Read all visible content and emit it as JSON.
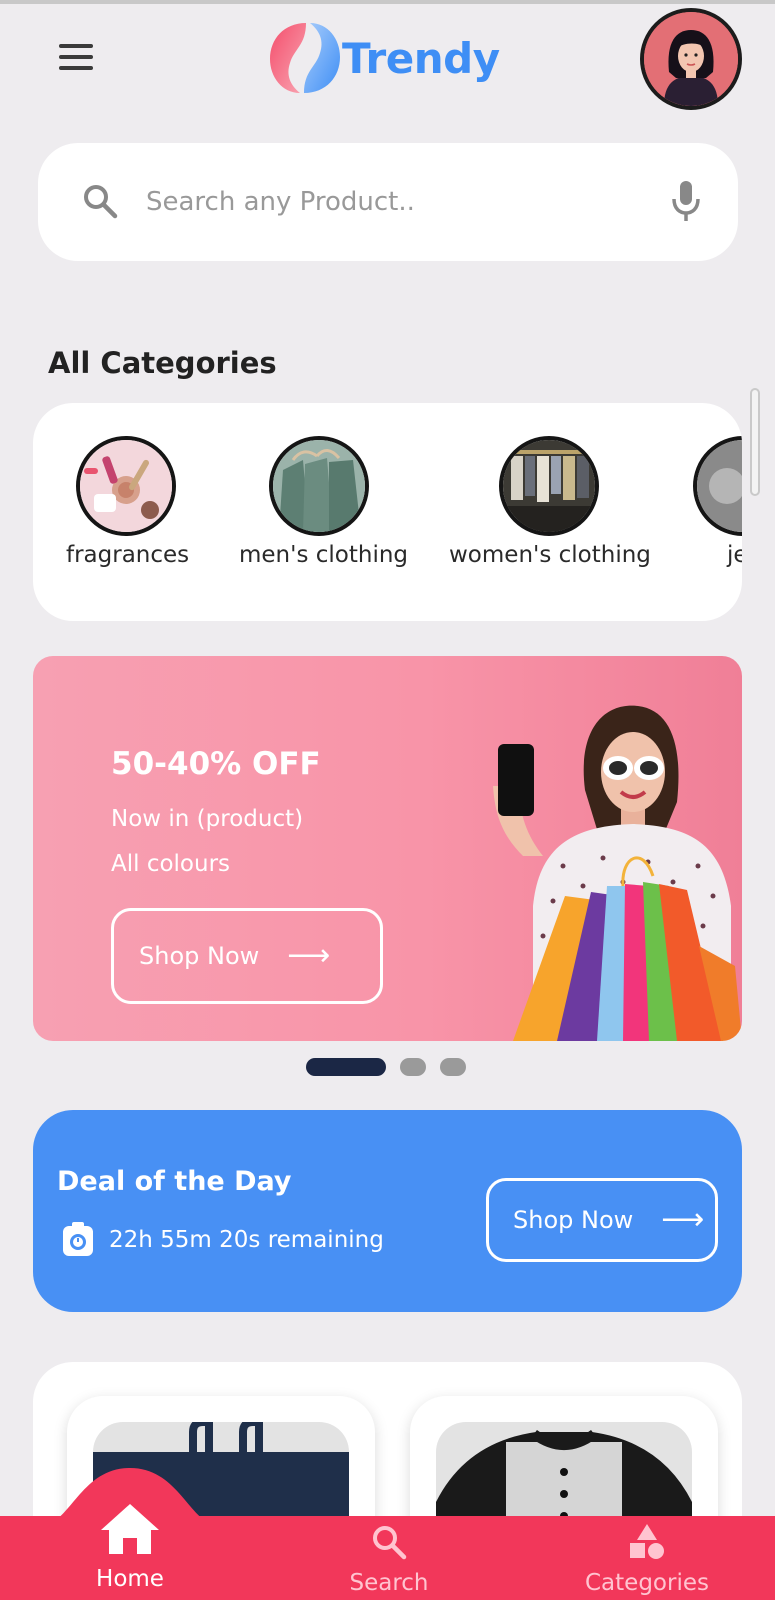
{
  "header": {
    "logo_text": "Trendy",
    "accent": "#3e8ef5"
  },
  "search": {
    "placeholder": "Search any Product.."
  },
  "categories": {
    "title": "All Categories",
    "items": [
      {
        "label": "fragrances"
      },
      {
        "label": "men's clothing"
      },
      {
        "label": "women's clothing"
      },
      {
        "label": "jew"
      }
    ]
  },
  "banner": {
    "headline": "50-40% OFF",
    "line1": "Now in (product)",
    "line2": "All colours",
    "button": "Shop Now",
    "bg_color": "#f894a8",
    "slides": 3,
    "active_slide": 1
  },
  "deal": {
    "title": "Deal of the Day",
    "remaining": "22h 55m 20s remaining",
    "button": "Shop Now",
    "bg_color": "#4890f4"
  },
  "bottom_nav": {
    "bg_color": "#f2375a",
    "items": [
      {
        "label": "Home",
        "icon": "home-icon",
        "active": true
      },
      {
        "label": "Search",
        "icon": "search-icon",
        "active": false
      },
      {
        "label": "Categories",
        "icon": "categories-icon",
        "active": false
      }
    ]
  }
}
